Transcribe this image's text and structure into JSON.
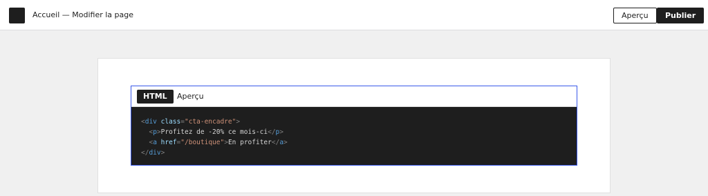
{
  "header": {
    "title": "Accueil — Modifier la page",
    "preview_label": "Aperçu",
    "publish_label": "Publier"
  },
  "block": {
    "tabs": [
      "HTML",
      "Aperçu"
    ],
    "active_tab": "HTML",
    "code": {
      "l1_tag": "div",
      "l1_attr": "class",
      "l1_val": "\"cta-encadre\"",
      "l2_tag": "p",
      "l2_text": "Profitez de -20% ce mois-ci",
      "l3_tag": "a",
      "l3_attr": "href",
      "l3_val": "\"/boutique\"",
      "l3_text": "En profiter",
      "l4_tag": "div"
    }
  },
  "colors": {
    "dark": "#1e1e1e",
    "accent": "#3858e9",
    "code_tag": "#569cd6",
    "code_attr": "#9cdcfe",
    "code_string": "#ce9178"
  }
}
